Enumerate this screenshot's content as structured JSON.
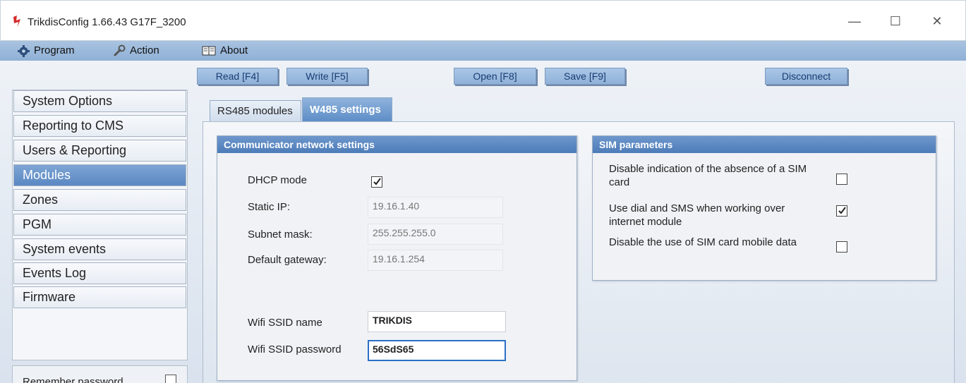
{
  "window": {
    "title": "TrikdisConfig 1.66.43    G17F_3200",
    "minimize_glyph": "—",
    "maximize_glyph": "☐",
    "close_glyph": "✕",
    "app_icon": "trikdis-logo-icon"
  },
  "menu": [
    {
      "label": "Program",
      "icon": "gear-icon"
    },
    {
      "label": "Action",
      "icon": "wrench-icon"
    },
    {
      "label": "About",
      "icon": "book-icon"
    }
  ],
  "toolbar": {
    "read": "Read [F4]",
    "write": "Write [F5]",
    "open": "Open [F8]",
    "save": "Save [F9]",
    "disconnect": "Disconnect"
  },
  "sidebar": {
    "items": [
      {
        "label": "System Options",
        "active": false
      },
      {
        "label": "Reporting to CMS",
        "active": false
      },
      {
        "label": "Users & Reporting",
        "active": false
      },
      {
        "label": "Modules",
        "active": true
      },
      {
        "label": "Zones",
        "active": false
      },
      {
        "label": "PGM",
        "active": false
      },
      {
        "label": "System events",
        "active": false
      },
      {
        "label": "Events Log",
        "active": false
      },
      {
        "label": "Firmware",
        "active": false
      }
    ],
    "remember_password": {
      "label": "Remember password",
      "checked": false
    }
  },
  "tabs": [
    {
      "label": "RS485 modules",
      "active": false
    },
    {
      "label": "W485 settings",
      "active": true
    }
  ],
  "network": {
    "title": "Communicator network settings",
    "dhcp_label": "DHCP mode",
    "dhcp_checked": true,
    "static_ip_label": "Static IP:",
    "static_ip_value": "19.16.1.40",
    "subnet_label": "Subnet mask:",
    "subnet_value": "255.255.255.0",
    "gateway_label": "Default gateway:",
    "gateway_value": "19.16.1.254",
    "ssid_label": "Wifi SSID name",
    "ssid_value": "TRIKDIS",
    "password_label": "Wifi SSID password",
    "password_value": "56SdS65"
  },
  "sim": {
    "title": "SIM parameters",
    "options": [
      {
        "label_line1": "Disable indication of the absence of a SIM",
        "label_line2": "card",
        "checked": false
      },
      {
        "label_line1": "Use dial and SMS when working over",
        "label_line2": "internet module",
        "checked": true
      },
      {
        "label_line1": "Disable the use of SIM card mobile data",
        "label_line2": "",
        "checked": false
      }
    ]
  }
}
